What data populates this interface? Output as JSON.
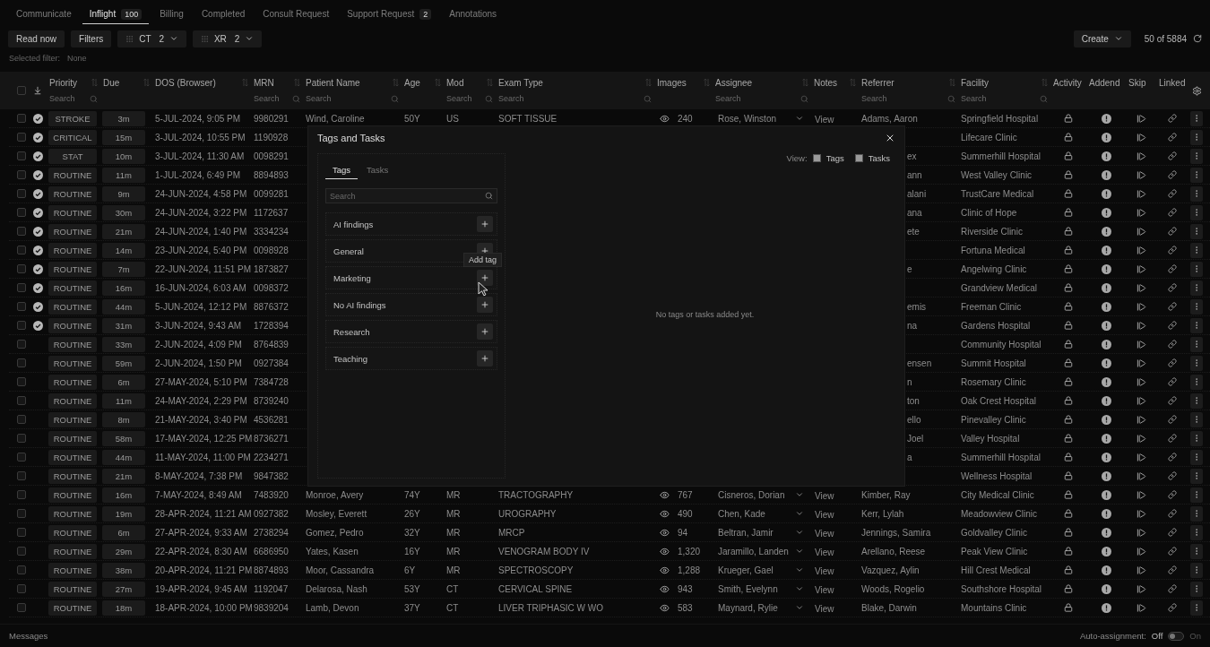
{
  "tabs": [
    {
      "label": "Communicate",
      "selected": false
    },
    {
      "label": "Inflight",
      "count": "100",
      "selected": true
    },
    {
      "label": "Billing",
      "selected": false
    },
    {
      "label": "Completed",
      "selected": false
    },
    {
      "label": "Consult Request",
      "selected": false
    },
    {
      "label": "Support Request",
      "count": "2",
      "selected": false
    },
    {
      "label": "Annotations",
      "selected": false
    }
  ],
  "toolbar": {
    "buttons": [
      "Read now",
      "Filters"
    ],
    "modalities": [
      {
        "label": "CT",
        "count": "2"
      },
      {
        "label": "XR",
        "count": "2"
      }
    ],
    "create": "Create",
    "result_count": "50 of 5884"
  },
  "selected_filter": {
    "label": "Selected filter:",
    "value": "None"
  },
  "table": {
    "select_all_checked": false,
    "columns": [
      {
        "label": "Priority",
        "sortable": true,
        "placeholder": "Search"
      },
      {
        "label": "Due",
        "sortable": true
      },
      {
        "label": "DOS (Browser)",
        "sortable": true
      },
      {
        "label": "MRN",
        "sortable": true,
        "placeholder": "Search"
      },
      {
        "label": "Patient Name",
        "sortable": true,
        "placeholder": "Search"
      },
      {
        "label": "Age",
        "sortable": true
      },
      {
        "label": "Mod",
        "sortable": true,
        "placeholder": "Search"
      },
      {
        "label": "Exam Type",
        "sortable": true,
        "placeholder": "Search"
      },
      {
        "label": "Images",
        "sortable": true
      },
      {
        "label": "Assignee",
        "sortable": true,
        "placeholder": "Search"
      },
      {
        "label": "Notes",
        "sortable": true
      },
      {
        "label": "Referrer",
        "sortable": true,
        "placeholder": "Search"
      },
      {
        "label": "Facility",
        "sortable": true,
        "placeholder": "Search"
      },
      {
        "label": "Activity"
      },
      {
        "label": "Addend"
      },
      {
        "label": "Skip"
      },
      {
        "label": "Linked"
      }
    ],
    "rows": [
      {
        "kind": "full",
        "checked": false,
        "reviewed": true,
        "priority": "STROKE",
        "due": "3m",
        "dos": "5-JUL-2024, 9:05 PM",
        "mrn": "9980291",
        "patient": "Wind, Caroline",
        "age": "50Y",
        "mod": "US",
        "exam": "SOFT TISSUE",
        "images": "240",
        "assignee": "Rose, Winston",
        "notes": "View",
        "referrer": "Adams, Aaron",
        "facility": "Springfield Hospital"
      },
      {
        "kind": "covered",
        "checked": false,
        "reviewed": true,
        "priority": "CRITICAL",
        "due": "15m",
        "dos": "3-JUL-2024, 10:55 PM",
        "mrn": "1190928",
        "facility": "Lifecare Clinic"
      },
      {
        "kind": "covered",
        "checked": false,
        "reviewed": true,
        "priority": "STAT",
        "due": "10m",
        "dos": "3-JUL-2024, 11:30 AM",
        "mrn": "0098291",
        "referrer": "ex",
        "facility": "Summerhill Hospital"
      },
      {
        "kind": "covered",
        "checked": false,
        "reviewed": true,
        "priority": "ROUTINE",
        "due": "11m",
        "dos": "1-JUL-2024, 6:49 PM",
        "mrn": "8894893",
        "referrer": "ann",
        "facility": "West Valley Clinic"
      },
      {
        "kind": "covered",
        "checked": false,
        "reviewed": true,
        "priority": "ROUTINE",
        "due": "9m",
        "dos": "24-JUN-2024, 4:58 PM",
        "mrn": "0099281",
        "referrer": "alani",
        "facility": "TrustCare Medical"
      },
      {
        "kind": "covered",
        "checked": false,
        "reviewed": true,
        "priority": "ROUTINE",
        "due": "30m",
        "dos": "24-JUN-2024, 3:22 PM",
        "mrn": "1172637",
        "referrer": "ana",
        "facility": "Clinic of Hope"
      },
      {
        "kind": "covered",
        "checked": false,
        "reviewed": true,
        "priority": "ROUTINE",
        "due": "21m",
        "dos": "24-JUN-2024, 1:40 PM",
        "mrn": "3334234",
        "referrer": "ete",
        "facility": "Riverside Clinic"
      },
      {
        "kind": "covered",
        "checked": false,
        "reviewed": true,
        "priority": "ROUTINE",
        "due": "14m",
        "dos": "23-JUN-2024, 5:40 PM",
        "mrn": "0098928",
        "facility": "Fortuna Medical"
      },
      {
        "kind": "covered",
        "checked": false,
        "reviewed": true,
        "priority": "ROUTINE",
        "due": "7m",
        "dos": "22-JUN-2024, 11:51 PM",
        "mrn": "1873827",
        "referrer": "e",
        "facility": "Angelwing Clinic"
      },
      {
        "kind": "covered",
        "checked": false,
        "reviewed": true,
        "priority": "ROUTINE",
        "due": "16m",
        "dos": "16-JUN-2024, 6:03 AM",
        "mrn": "0098372",
        "facility": "Grandview Medical"
      },
      {
        "kind": "covered",
        "checked": false,
        "reviewed": true,
        "priority": "ROUTINE",
        "due": "44m",
        "dos": "5-JUN-2024, 12:12 PM",
        "mrn": "8876372",
        "referrer": "emis",
        "facility": "Freeman Clinic"
      },
      {
        "kind": "covered",
        "checked": false,
        "reviewed": true,
        "priority": "ROUTINE",
        "due": "31m",
        "dos": "3-JUN-2024, 9:43 AM",
        "mrn": "1728394",
        "referrer": "na",
        "facility": "Gardens Hospital"
      },
      {
        "kind": "covered",
        "checked": false,
        "reviewed": false,
        "priority": "ROUTINE",
        "due": "33m",
        "dos": "2-JUN-2024, 4:09 PM",
        "mrn": "8764839",
        "facility": "Community Hospital"
      },
      {
        "kind": "covered",
        "checked": false,
        "reviewed": false,
        "priority": "ROUTINE",
        "due": "59m",
        "dos": "2-JUN-2024, 1:50 PM",
        "mrn": "0927384",
        "referrer": "ensen",
        "facility": "Summit Hospital"
      },
      {
        "kind": "covered",
        "checked": false,
        "reviewed": false,
        "priority": "ROUTINE",
        "due": "6m",
        "dos": "27-MAY-2024, 5:10 PM",
        "mrn": "7384728",
        "referrer": "n",
        "facility": "Rosemary Clinic"
      },
      {
        "kind": "covered",
        "checked": false,
        "reviewed": false,
        "priority": "ROUTINE",
        "due": "11m",
        "dos": "24-MAY-2024, 2:29 PM",
        "mrn": "8739240",
        "referrer": "ton",
        "facility": "Oak Crest Hospital"
      },
      {
        "kind": "covered",
        "checked": false,
        "reviewed": false,
        "priority": "ROUTINE",
        "due": "8m",
        "dos": "21-MAY-2024, 3:40 PM",
        "mrn": "4536281",
        "referrer": "ello",
        "facility": "Pinevalley Clinic"
      },
      {
        "kind": "covered",
        "checked": false,
        "reviewed": false,
        "priority": "ROUTINE",
        "due": "58m",
        "dos": "17-MAY-2024, 12:25 PM",
        "mrn": "8736271",
        "referrer": "Joel",
        "facility": "Valley Hospital"
      },
      {
        "kind": "covered",
        "checked": false,
        "reviewed": false,
        "priority": "ROUTINE",
        "due": "44m",
        "dos": "11-MAY-2024, 11:00 PM",
        "mrn": "2234271",
        "referrer": "a",
        "facility": "Summerhill Hospital"
      },
      {
        "kind": "covered",
        "checked": false,
        "reviewed": false,
        "priority": "ROUTINE",
        "due": "21m",
        "dos": "8-MAY-2024, 7:38 PM",
        "mrn": "9847382",
        "facility": "Wellness Hospital"
      },
      {
        "kind": "full",
        "checked": false,
        "reviewed": false,
        "priority": "ROUTINE",
        "due": "16m",
        "dos": "7-MAY-2024, 8:49 AM",
        "mrn": "7483920",
        "patient": "Monroe, Avery",
        "age": "74Y",
        "mod": "MR",
        "exam": "TRACTOGRAPHY",
        "images": "767",
        "assignee": "Cisneros, Dorian",
        "notes": "View",
        "referrer": "Kimber, Ray",
        "facility": "City Medical Clinic"
      },
      {
        "kind": "full",
        "checked": false,
        "reviewed": false,
        "priority": "ROUTINE",
        "due": "19m",
        "dos": "28-APR-2024, 11:21 AM",
        "mrn": "0927382",
        "patient": "Mosley, Everett",
        "age": "26Y",
        "mod": "MR",
        "exam": "UROGRAPHY",
        "images": "490",
        "assignee": "Chen, Kade",
        "notes": "View",
        "referrer": "Kerr, Lylah",
        "facility": "Meadowview Clinic"
      },
      {
        "kind": "full",
        "checked": false,
        "reviewed": false,
        "priority": "ROUTINE",
        "due": "6m",
        "dos": "27-APR-2024, 9:33 AM",
        "mrn": "2738294",
        "patient": "Gomez, Pedro",
        "age": "32Y",
        "mod": "MR",
        "exam": "MRCP",
        "images": "94",
        "assignee": "Beltran, Jamir",
        "notes": "View",
        "referrer": "Jennings, Samira",
        "facility": "Goldvalley Clinic"
      },
      {
        "kind": "full",
        "checked": false,
        "reviewed": false,
        "priority": "ROUTINE",
        "due": "29m",
        "dos": "22-APR-2024, 8:30 AM",
        "mrn": "6686950",
        "patient": "Yates, Kasen",
        "age": "16Y",
        "mod": "MR",
        "exam": "VENOGRAM BODY IV",
        "images": "1,320",
        "assignee": "Jaramillo, Landen",
        "notes": "View",
        "referrer": "Arellano, Reese",
        "facility": "Peak View Clinic"
      },
      {
        "kind": "full",
        "checked": false,
        "reviewed": false,
        "priority": "ROUTINE",
        "due": "38m",
        "dos": "20-APR-2024, 11:21 PM",
        "mrn": "8874893",
        "patient": "Moor, Cassandra",
        "age": "6Y",
        "mod": "MR",
        "exam": "SPECTROSCOPY",
        "images": "1,288",
        "assignee": "Krueger, Gael",
        "notes": "View",
        "referrer": "Vazquez, Aylin",
        "facility": "Hill Crest Medical"
      },
      {
        "kind": "full",
        "checked": false,
        "reviewed": false,
        "priority": "ROUTINE",
        "due": "27m",
        "dos": "19-APR-2024, 9:45 AM",
        "mrn": "1192047",
        "patient": "Delarosa, Nash",
        "age": "53Y",
        "mod": "CT",
        "exam": "CERVICAL SPINE",
        "images": "943",
        "assignee": "Smith, Evelynn",
        "notes": "View",
        "referrer": "Woods, Rogelio",
        "facility": "Southshore Hospital"
      },
      {
        "kind": "full",
        "checked": false,
        "reviewed": false,
        "priority": "ROUTINE",
        "due": "18m",
        "dos": "18-APR-2024, 10:00 PM",
        "mrn": "9839204",
        "patient": "Lamb, Devon",
        "age": "37Y",
        "mod": "CT",
        "exam": "LIVER TRIPHASIC W WO",
        "images": "583",
        "assignee": "Maynard, Rylie",
        "notes": "View",
        "referrer": "Blake, Darwin",
        "facility": "Mountains Clinic"
      }
    ]
  },
  "modal": {
    "title": "Tags and Tasks",
    "tabs": [
      {
        "label": "Tags",
        "selected": true
      },
      {
        "label": "Tasks",
        "selected": false
      }
    ],
    "search": {
      "placeholder": "Search"
    },
    "tags": [
      {
        "label": "AI findings"
      },
      {
        "label": "General"
      },
      {
        "label": "Marketing",
        "tooltip": "Add tag"
      },
      {
        "label": "No AI findings"
      },
      {
        "label": "Research"
      },
      {
        "label": "Teaching"
      }
    ],
    "view": {
      "label": "View:",
      "options": [
        {
          "label": "Tags",
          "checked": true
        },
        {
          "label": "Tasks",
          "checked": true
        }
      ]
    },
    "empty_message": "No tags or tasks added yet."
  },
  "footer": {
    "messages": "Messages",
    "auto_assignment": {
      "label": "Auto-assignment:",
      "off": "Off",
      "on_label": "On",
      "on": false
    }
  }
}
